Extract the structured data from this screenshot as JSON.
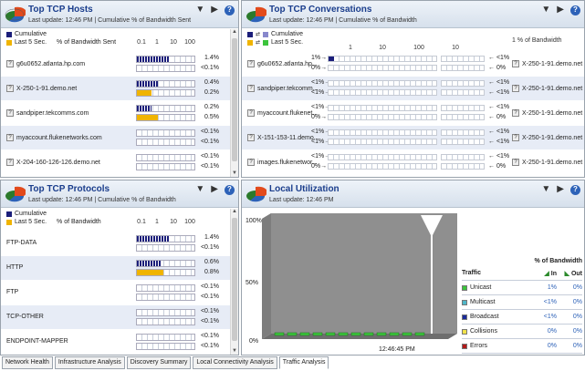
{
  "tabs": [
    "Network Health",
    "Infrastructure Analysis",
    "Discovery Summary",
    "Local Connectivity Analysis",
    "Traffic Analysis"
  ],
  "active_tab": "Traffic Analysis",
  "colors": {
    "cumulative": "#1b1e7a",
    "last5": "#f0b400",
    "title": "#1a3d8c"
  },
  "hosts": {
    "title": "Top TCP Hosts",
    "subtitle": "Last update: 12:46 PM | Cumulative % of Bandwidth Sent",
    "legend_cumulative": "Cumulative",
    "legend_last5": "Last 5 Sec.",
    "legend_metric": "% of Bandwidth Sent",
    "scale": [
      "0.1",
      "1",
      "10",
      "100"
    ],
    "rows": [
      {
        "name": "g6u0652.atlanta.hp.com",
        "cum": "1.4%",
        "last5": "<0.1%",
        "cum_frac": 0.57,
        "last5_frac": 0.0
      },
      {
        "name": "X-250-1-91.demo.net",
        "cum": "0.4%",
        "last5": "0.2%",
        "cum_frac": 0.37,
        "last5_frac": 0.25
      },
      {
        "name": "sandpiper.tekcomms.com",
        "cum": "0.2%",
        "last5": "0.5%",
        "cum_frac": 0.25,
        "last5_frac": 0.37
      },
      {
        "name": "myaccount.flukenetworks.com",
        "cum": "<0.1%",
        "last5": "<0.1%",
        "cum_frac": 0.0,
        "last5_frac": 0.0
      },
      {
        "name": "X-204-160-126-126.demo.net",
        "cum": "<0.1%",
        "last5": "<0.1%",
        "cum_frac": 0.0,
        "last5_frac": 0.0
      }
    ]
  },
  "conversations": {
    "title": "Top TCP Conversations",
    "subtitle": "Last update: 12:46 PM | Cumulative % of Bandwidth",
    "legend_cumulative": "Cumulative",
    "legend_last5": "Last 5 Sec.",
    "scale": [
      "1",
      "10",
      "100",
      "10"
    ],
    "scale_right": "1",
    "metric": "% of Bandwidth",
    "rows": [
      {
        "src": "g6u0652.atlanta.hp...",
        "left_top": "1%",
        "left_bot": "0%",
        "right_top": "<1%",
        "right_bot": "0%",
        "dst": "X-250-1-91.demo.net",
        "fill": 0.05
      },
      {
        "src": "sandpiper.tekcomm...",
        "left_top": "<1%",
        "left_bot": "<1%",
        "right_top": "<1%",
        "right_bot": "<1%",
        "dst": "X-250-1-91.demo.net",
        "fill": 0.0
      },
      {
        "src": "myaccount.flukenet...",
        "left_top": "<1%",
        "left_bot": "0%",
        "right_top": "<1%",
        "right_bot": "0%",
        "dst": "X-250-1-91.demo.net",
        "fill": 0.0
      },
      {
        "src": "X-151-153-11.demo...",
        "left_top": "<1%",
        "left_bot": "<1%",
        "right_top": "<1%",
        "right_bot": "<1%",
        "dst": "X-250-1-91.demo.net",
        "fill": 0.0
      },
      {
        "src": "images.flukenetwor...",
        "left_top": "<1%",
        "left_bot": "0%",
        "right_top": "<1%",
        "right_bot": "0%",
        "dst": "X-250-1-91.demo.net",
        "fill": 0.0
      }
    ]
  },
  "protocols": {
    "title": "Top TCP Protocols",
    "subtitle": "Last update: 12:46 PM | Cumulative % of Bandwidth",
    "legend_cumulative": "Cumulative",
    "legend_last5": "Last 5 Sec.",
    "legend_metric": "% of Bandwidth",
    "scale": [
      "0.1",
      "1",
      "10",
      "100"
    ],
    "rows": [
      {
        "name": "FTP-DATA",
        "cum": "1.4%",
        "last5": "<0.1%",
        "cum_frac": 0.57,
        "last5_frac": 0.0
      },
      {
        "name": "HTTP",
        "cum": "0.6%",
        "last5": "0.8%",
        "cum_frac": 0.42,
        "last5_frac": 0.46
      },
      {
        "name": "FTP",
        "cum": "<0.1%",
        "last5": "<0.1%",
        "cum_frac": 0.0,
        "last5_frac": 0.0
      },
      {
        "name": "TCP-OTHER",
        "cum": "<0.1%",
        "last5": "<0.1%",
        "cum_frac": 0.0,
        "last5_frac": 0.0
      },
      {
        "name": "ENDPOINT-MAPPER",
        "cum": "<0.1%",
        "last5": "<0.1%",
        "cum_frac": 0.0,
        "last5_frac": 0.0
      }
    ]
  },
  "utilization": {
    "title": "Local Utilization",
    "subtitle": "Last update: 12:46 PM",
    "y_labels": [
      "100%",
      "50%",
      "0%"
    ],
    "x_label": "12:46:45 PM",
    "table_header": "% of Bandwidth",
    "col_traffic": "Traffic",
    "col_in": "In",
    "col_out": "Out",
    "rows": [
      {
        "name": "Unicast",
        "color": "#3cc43c",
        "in": "1%",
        "out": "0%"
      },
      {
        "name": "Multicast",
        "color": "#4fb6c8",
        "in": "<1%",
        "out": "0%"
      },
      {
        "name": "Broadcast",
        "color": "#1b2a9a",
        "in": "<1%",
        "out": "0%"
      },
      {
        "name": "Collisions",
        "color": "#f1e24a",
        "in": "0%",
        "out": "0%"
      },
      {
        "name": "Errors",
        "color": "#b21a1a",
        "in": "0%",
        "out": "0%"
      }
    ],
    "chart_data": {
      "type": "bar",
      "y_range": [
        0,
        100
      ],
      "series": [
        {
          "name": "Unicast",
          "values": [
            1,
            1,
            1,
            1,
            1,
            1,
            1,
            1,
            1,
            1,
            1,
            1
          ]
        }
      ]
    }
  }
}
